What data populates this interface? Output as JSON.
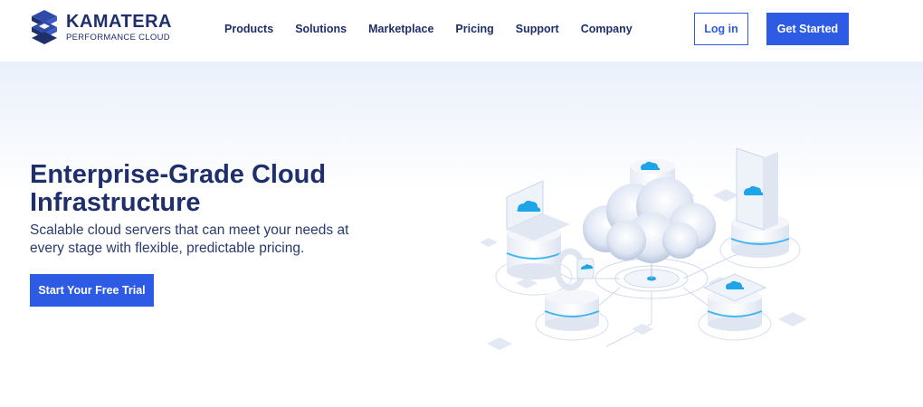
{
  "brand": {
    "name": "KAMATERA",
    "tagline": "PERFORMANCE CLOUD",
    "color": "#1e2f6c"
  },
  "nav": {
    "items": [
      "Products",
      "Solutions",
      "Marketplace",
      "Pricing",
      "Support",
      "Company"
    ]
  },
  "header": {
    "login_label": "Log in",
    "cta_label": "Get Started"
  },
  "hero": {
    "title": "Enterprise-Grade Cloud Infrastructure",
    "subtitle": "Scalable cloud servers that can meet your needs at every stage with flexible, predictable pricing.",
    "cta_label": "Start Your Free Trial"
  },
  "colors": {
    "accent": "#2d5be3",
    "heading": "#1e2f6c",
    "hero_bg": "#eaf0fb",
    "cloud_icon": "#1ea5e8"
  },
  "illustration": {
    "icons": [
      "cloud-icon",
      "laptop-icon",
      "tablet-icon",
      "server-icon",
      "watch-icon"
    ]
  }
}
